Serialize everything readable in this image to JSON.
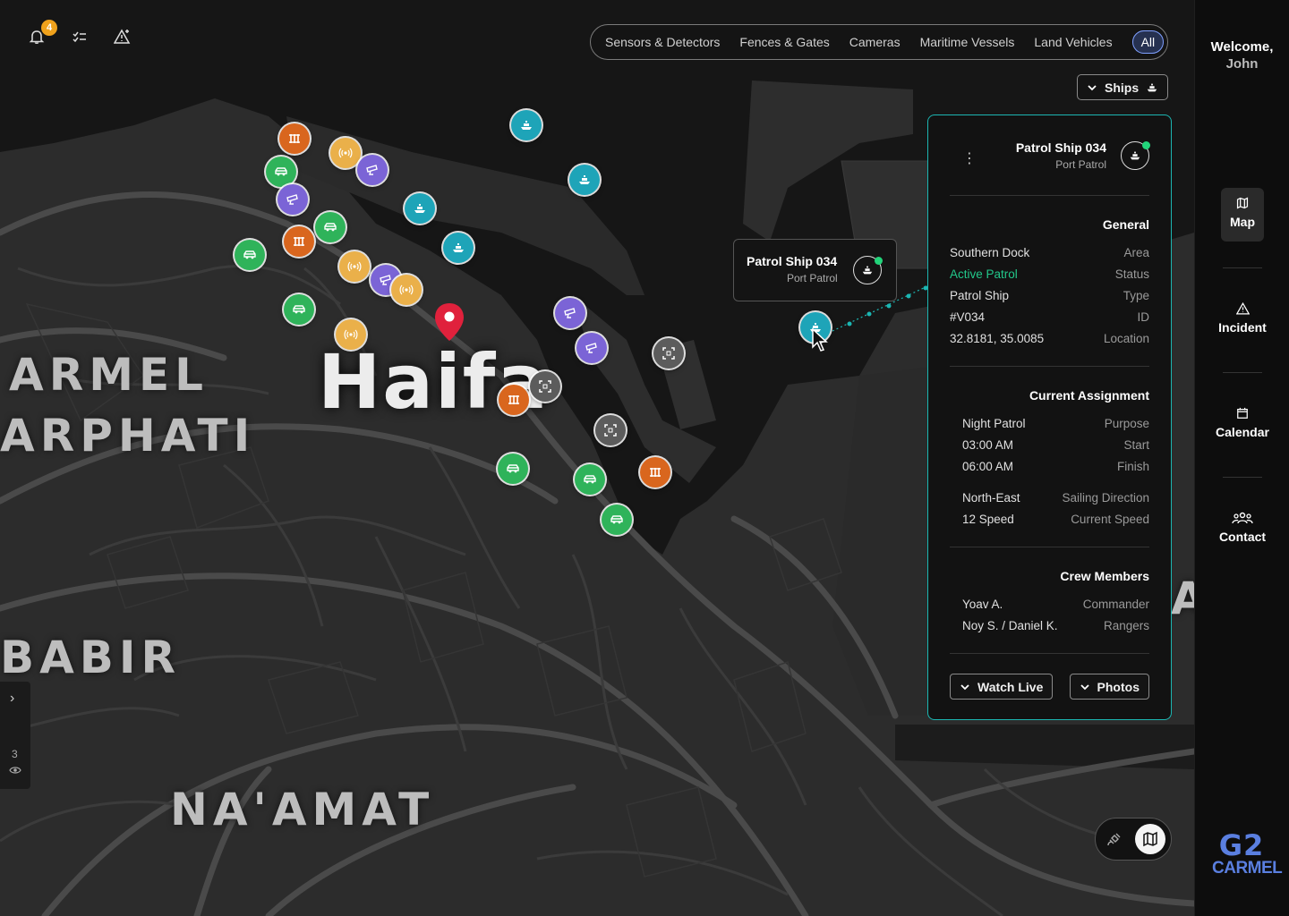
{
  "notifications": {
    "count": "4"
  },
  "filters": [
    "Sensors & Detectors",
    "Fences & Gates",
    "Cameras",
    "Maritime Vessels",
    "Land Vehicles"
  ],
  "filter_all": "All",
  "ships_dropdown": "Ships",
  "map_labels": {
    "city": "Haifa",
    "carmel": "ARMEL",
    "carphati": "ARPHATI",
    "babir": "BABIR",
    "naamat": "NA'AMAT",
    "edge": "A"
  },
  "tooltip": {
    "title": "Patrol Ship 034",
    "subtitle": "Port Patrol"
  },
  "panel": {
    "title": "Patrol Ship 034",
    "subtitle": "Port Patrol",
    "general": {
      "heading": "General",
      "rows": [
        {
          "v": "Southern Dock",
          "k": "Area"
        },
        {
          "v": "Active Patrol",
          "k": "Status"
        },
        {
          "v": "Patrol Ship",
          "k": "Type"
        },
        {
          "v": "#V034",
          "k": "ID"
        },
        {
          "v": "32.8181, 35.0085",
          "k": "Location"
        }
      ]
    },
    "assignment": {
      "heading": "Current Assignment",
      "rows": [
        {
          "v": "Night Patrol",
          "k": "Purpose"
        },
        {
          "v": "03:00 AM",
          "k": "Start"
        },
        {
          "v": "06:00 AM",
          "k": "Finish"
        }
      ],
      "rows2": [
        {
          "v": "North-East",
          "k": "Sailing Direction"
        },
        {
          "v": "12 Speed",
          "k": "Current Speed"
        }
      ]
    },
    "crew": {
      "heading": "Crew Members",
      "rows": [
        {
          "v": "Yoav A.",
          "k": "Commander"
        },
        {
          "v": "Noy S. / Daniel K.",
          "k": "Rangers"
        }
      ]
    },
    "watch_live": "Watch Live",
    "photos": "Photos"
  },
  "layers_count": "3",
  "sidebar": {
    "welcome": "Welcome,",
    "user": "John",
    "nav": [
      "Map",
      "Incident",
      "Calendar",
      "Contact"
    ]
  },
  "logo": {
    "top": "G2",
    "bottom": "CARMEL"
  },
  "colors": {
    "accent": "#1cb6b2",
    "status_active": "#22c78a",
    "alert": "#e0213c",
    "badge": "#f0a21c"
  }
}
